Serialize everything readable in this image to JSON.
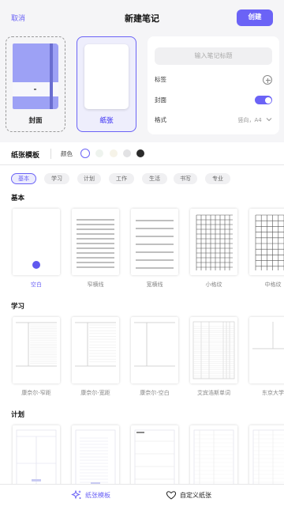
{
  "header": {
    "cancel_label": "取消",
    "title": "新建笔记",
    "create_label": "创建"
  },
  "cards": {
    "cover_label": "封面",
    "paper_label": "纸张"
  },
  "settings": {
    "title_placeholder": "输入笔记标题",
    "tag_label": "标签",
    "cover_label": "封面",
    "cover_toggle_on": true,
    "format_label": "格式",
    "format_value": "竖向，A4"
  },
  "templates": {
    "title": "纸张模板",
    "color_label": "颜色",
    "colors": [
      "#ffffff",
      "#eef3ee",
      "#f6f3e8",
      "#e2e2e4",
      "#2b2b2b"
    ],
    "selected_color": 0,
    "chips": [
      "基本",
      "学习",
      "计划",
      "工作",
      "生活",
      "书写",
      "专业"
    ],
    "active_chip": 0
  },
  "sections": [
    {
      "title": "基本",
      "items": [
        {
          "label": "空白",
          "pattern": "blank",
          "selected": true
        },
        {
          "label": "窄横线",
          "pattern": "narrow-lines"
        },
        {
          "label": "宽横线",
          "pattern": "wide-lines"
        },
        {
          "label": "小格纹",
          "pattern": "small-grid"
        },
        {
          "label": "中格纹",
          "pattern": "medium-grid"
        }
      ]
    },
    {
      "title": "学习",
      "items": [
        {
          "label": "康奈尔-窄距",
          "pattern": "cornell-narrow"
        },
        {
          "label": "康奈尔-宽距",
          "pattern": "cornell-wide"
        },
        {
          "label": "康奈尔-空白",
          "pattern": "cornell-blank"
        },
        {
          "label": "艾宾浩斯单词",
          "pattern": "ebbinghaus"
        },
        {
          "label": "东京大学",
          "pattern": "tokyo"
        }
      ]
    },
    {
      "title": "计划",
      "items": [
        {
          "label": "",
          "pattern": "planner-a"
        },
        {
          "label": "",
          "pattern": "planner-b"
        },
        {
          "label": "",
          "pattern": "planner-c"
        },
        {
          "label": "",
          "pattern": "planner-d"
        },
        {
          "label": "",
          "pattern": "planner-e"
        }
      ]
    }
  ],
  "bottom_bar": {
    "left_label": "纸张模板",
    "left_icon": "sparkle-icon",
    "right_label": "自定义纸张",
    "right_icon": "heart-icon"
  },
  "accent_color": "#6b63f6"
}
